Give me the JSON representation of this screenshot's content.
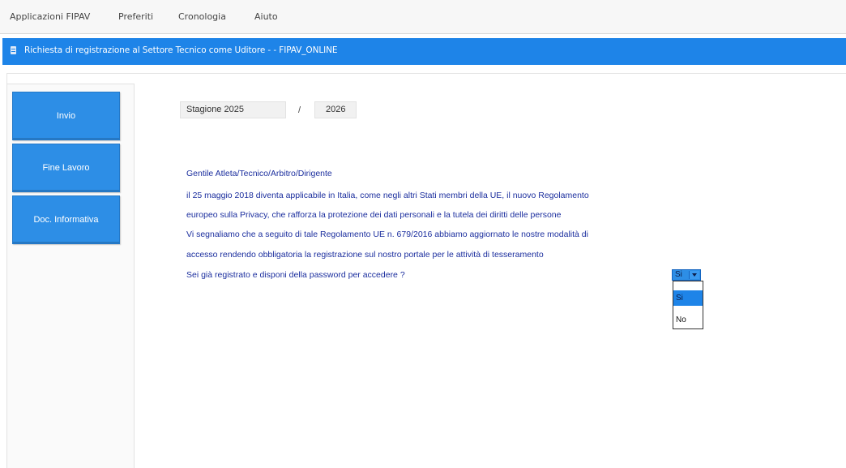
{
  "menubar": {
    "items": [
      "Applicazioni FIPAV",
      "Preferiti",
      "Cronologia",
      "Aiuto"
    ]
  },
  "titlebar": {
    "title": "Richiesta di registrazione al Settore Tecnico come Uditore - - FIPAV_ONLINE"
  },
  "sidebar": {
    "buttons": [
      "Invio",
      "Fine Lavoro",
      "Doc. Informativa"
    ]
  },
  "season": {
    "start_label": "Stagione 2025",
    "separator": "/",
    "end_value": "2026"
  },
  "message": {
    "lines": [
      "Gentile Atleta/Tecnico/Arbitro/Dirigente",
      "il 25 maggio 2018 diventa applicabile in Italia, come negli altri Stati membri della UE, il nuovo Regolamento",
      "europeo sulla Privacy, che rafforza la protezione dei dati personali e la tutela dei diritti delle persone",
      "Vi segnaliamo che a seguito di tale Regolamento UE n. 679/2016 abbiamo aggiornato le nostre modalità di",
      "accesso rendendo obbligatoria la registrazione sul nostro portale per le attività di tesseramento",
      "Sei già registrato e disponi della password per accedere ?"
    ]
  },
  "registered_select": {
    "selected": "Si",
    "options": [
      "Si",
      "No"
    ]
  },
  "colors": {
    "accent": "#1e84e8",
    "button": "#2d8ee6",
    "text": "#1b2e9e"
  }
}
